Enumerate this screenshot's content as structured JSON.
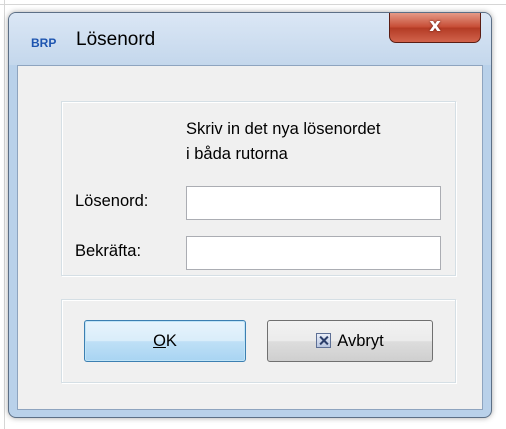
{
  "window": {
    "logo_text": "BRP",
    "title": "Lösenord",
    "close_glyph": "x"
  },
  "form": {
    "instruction_line1": "Skriv in det nya lösenordet",
    "instruction_line2": "i båda rutorna",
    "password_label": "Lösenord:",
    "password_value": "",
    "confirm_label": "Bekräfta:",
    "confirm_value": ""
  },
  "buttons": {
    "ok_label_mnemonic": "O",
    "ok_label_rest": "K",
    "cancel_label": "Avbryt",
    "cancel_icon": "cancel-x-icon"
  },
  "colors": {
    "title_bar": "#c4d7ec",
    "close_button": "#c54a33",
    "dialog_background": "#f0f0f0",
    "default_button_border": "#3c7fb1",
    "logo": "#1e55b0"
  }
}
